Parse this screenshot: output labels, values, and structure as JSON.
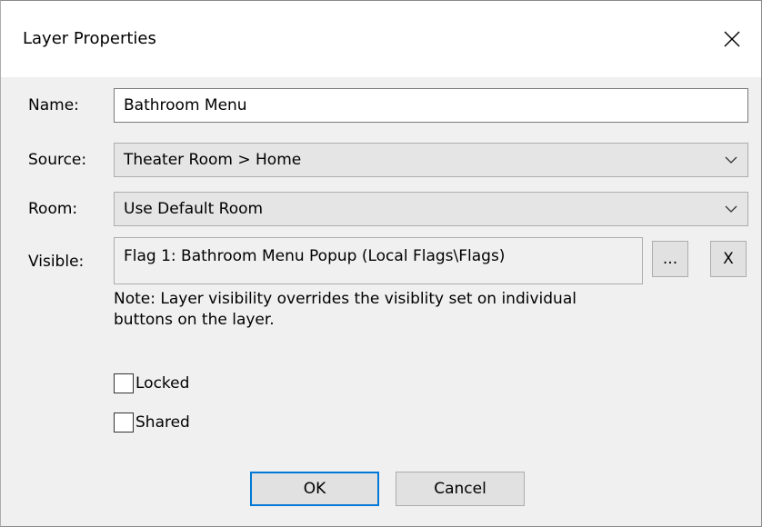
{
  "window": {
    "title": "Layer Properties",
    "close_icon": "close-icon"
  },
  "form": {
    "name_label": "Name:",
    "name_value": "Bathroom Menu",
    "source_label": "Source:",
    "source_value": "Theater Room > Home",
    "room_label": "Room:",
    "room_value": "Use Default Room",
    "visible_label": "Visible:",
    "visible_value": "Flag 1: Bathroom Menu Popup (Local Flags\\Flags)",
    "browse_label": "...",
    "clear_label": "X",
    "note_line1": "Note: Layer visibility overrides the visiblity set on individual",
    "note_line2": "buttons on the layer.",
    "locked_label": "Locked",
    "locked_checked": false,
    "shared_label": "Shared",
    "shared_checked": false
  },
  "buttons": {
    "ok_label": "OK",
    "cancel_label": "Cancel"
  },
  "colors": {
    "accent": "#0078d7",
    "dialog_bg": "#f0f0f0",
    "titlebar_bg": "#ffffff"
  }
}
